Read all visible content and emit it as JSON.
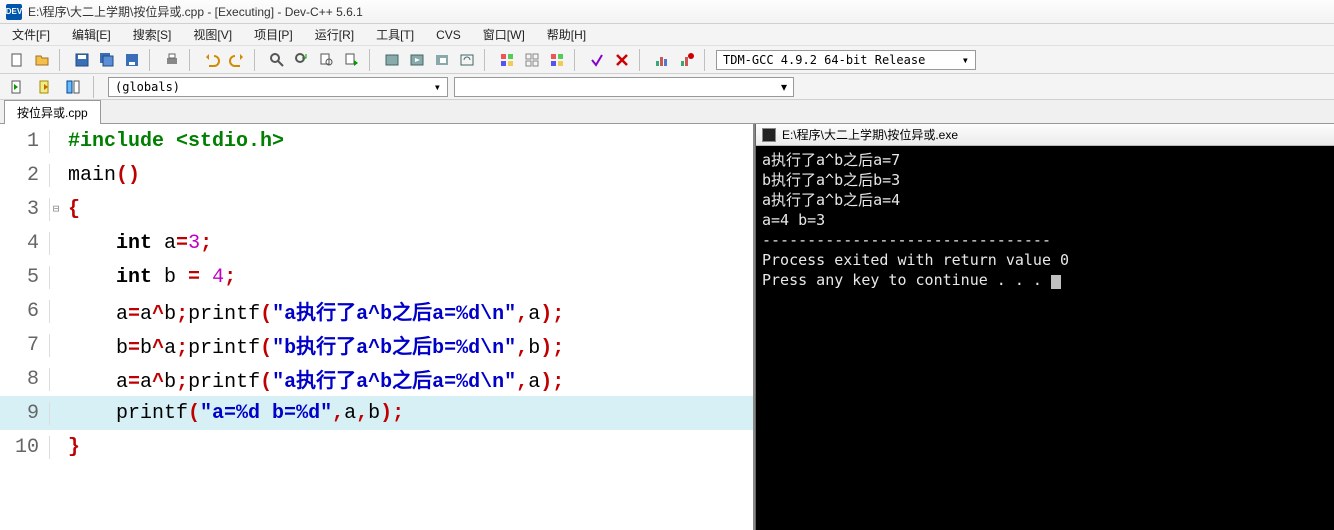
{
  "titlebar": {
    "icon_label": "DEV",
    "text": "E:\\程序\\大二上学期\\按位异或.cpp - [Executing] - Dev-C++ 5.6.1"
  },
  "menu": {
    "file": "文件[F]",
    "edit": "编辑[E]",
    "search": "搜索[S]",
    "view": "视图[V]",
    "project": "项目[P]",
    "run": "运行[R]",
    "tools": "工具[T]",
    "cvs": "CVS",
    "window": "窗口[W]",
    "help": "帮助[H]"
  },
  "toolbar": {
    "compiler": "TDM-GCC 4.9.2 64-bit Release"
  },
  "secondbar": {
    "globals": "(globals)"
  },
  "tab": {
    "label": "按位异或.cpp"
  },
  "code": {
    "lines": [
      {
        "n": "1",
        "tokens": [
          [
            "kw-green",
            "#include <stdio.h>"
          ]
        ]
      },
      {
        "n": "2",
        "tokens": [
          [
            "ident",
            "main"
          ],
          [
            "punct",
            "()"
          ]
        ]
      },
      {
        "n": "3",
        "fold": "⊟",
        "tokens": [
          [
            "punct",
            "{"
          ]
        ]
      },
      {
        "n": "4",
        "indent": "    ",
        "tokens": [
          [
            "kw-bold",
            "int"
          ],
          [
            "ident",
            " a"
          ],
          [
            "punct",
            "="
          ],
          [
            "num",
            "3"
          ],
          [
            "punct",
            ";"
          ]
        ]
      },
      {
        "n": "5",
        "indent": "    ",
        "tokens": [
          [
            "kw-bold",
            "int"
          ],
          [
            "ident",
            " b "
          ],
          [
            "punct",
            "="
          ],
          [
            "ident",
            " "
          ],
          [
            "num",
            "4"
          ],
          [
            "punct",
            ";"
          ]
        ]
      },
      {
        "n": "6",
        "indent": "    ",
        "tokens": [
          [
            "ident",
            "a"
          ],
          [
            "punct",
            "="
          ],
          [
            "ident",
            "a"
          ],
          [
            "punct",
            "^"
          ],
          [
            "ident",
            "b"
          ],
          [
            "punct",
            ";"
          ],
          [
            "ident",
            "printf"
          ],
          [
            "punct",
            "("
          ],
          [
            "str",
            "\"a执行了a^b之后a=%d\\n\""
          ],
          [
            "punct",
            ","
          ],
          [
            "ident",
            "a"
          ],
          [
            "punct",
            ");"
          ]
        ]
      },
      {
        "n": "7",
        "indent": "    ",
        "tokens": [
          [
            "ident",
            "b"
          ],
          [
            "punct",
            "="
          ],
          [
            "ident",
            "b"
          ],
          [
            "punct",
            "^"
          ],
          [
            "ident",
            "a"
          ],
          [
            "punct",
            ";"
          ],
          [
            "ident",
            "printf"
          ],
          [
            "punct",
            "("
          ],
          [
            "str",
            "\"b执行了a^b之后b=%d\\n\""
          ],
          [
            "punct",
            ","
          ],
          [
            "ident",
            "b"
          ],
          [
            "punct",
            ");"
          ]
        ]
      },
      {
        "n": "8",
        "indent": "    ",
        "tokens": [
          [
            "ident",
            "a"
          ],
          [
            "punct",
            "="
          ],
          [
            "ident",
            "a"
          ],
          [
            "punct",
            "^"
          ],
          [
            "ident",
            "b"
          ],
          [
            "punct",
            ";"
          ],
          [
            "ident",
            "printf"
          ],
          [
            "punct",
            "("
          ],
          [
            "str",
            "\"a执行了a^b之后a=%d\\n\""
          ],
          [
            "punct",
            ","
          ],
          [
            "ident",
            "a"
          ],
          [
            "punct",
            ");"
          ]
        ]
      },
      {
        "n": "9",
        "hl": true,
        "indent": "    ",
        "tokens": [
          [
            "ident",
            "printf"
          ],
          [
            "punct",
            "("
          ],
          [
            "str",
            "\"a=%d b=%d\""
          ],
          [
            "punct",
            ","
          ],
          [
            "ident",
            "a"
          ],
          [
            "punct",
            ","
          ],
          [
            "ident",
            "b"
          ],
          [
            "punct",
            ");"
          ]
        ]
      },
      {
        "n": "10",
        "tokens": [
          [
            "punct",
            "}"
          ]
        ]
      }
    ]
  },
  "console": {
    "title": "E:\\程序\\大二上学期\\按位异或.exe",
    "lines": [
      "a执行了a^b之后a=7",
      "b执行了a^b之后b=3",
      "a执行了a^b之后a=4",
      "a=4 b=3",
      "--------------------------------",
      "Process exited with return value 0",
      "Press any key to continue . . . "
    ]
  }
}
